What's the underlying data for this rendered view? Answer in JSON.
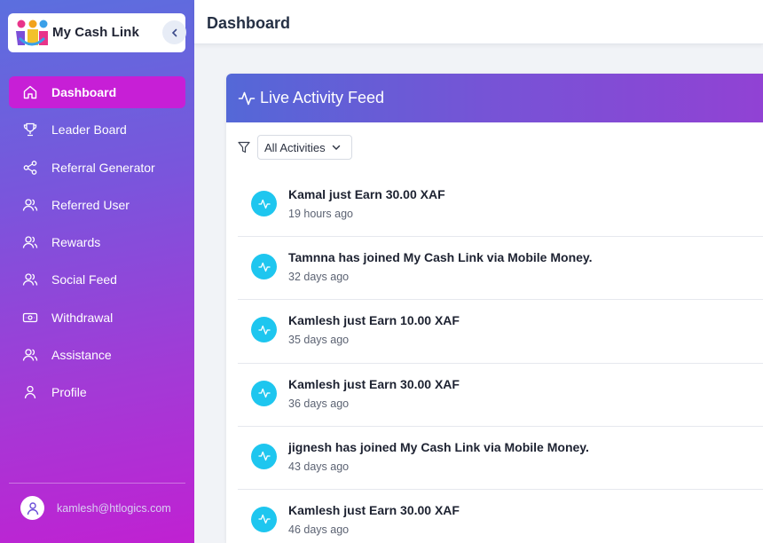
{
  "brand": {
    "name": "My Cash Link"
  },
  "sidebar": {
    "items": [
      {
        "label": "Dashboard",
        "icon": "home-icon",
        "active": true
      },
      {
        "label": "Leader Board",
        "icon": "trophy-icon",
        "active": false
      },
      {
        "label": "Referral Generator",
        "icon": "share-icon",
        "active": false
      },
      {
        "label": "Referred User",
        "icon": "users-icon",
        "active": false
      },
      {
        "label": "Rewards",
        "icon": "users-icon",
        "active": false
      },
      {
        "label": "Social Feed",
        "icon": "users-icon",
        "active": false
      },
      {
        "label": "Withdrawal",
        "icon": "cash-icon",
        "active": false
      },
      {
        "label": "Assistance",
        "icon": "users-icon",
        "active": false
      },
      {
        "label": "Profile",
        "icon": "user-icon",
        "active": false
      }
    ],
    "user_email": "kamlesh@htlogics.com"
  },
  "header": {
    "title": "Dashboard"
  },
  "activity": {
    "title": "Live Activity Feed",
    "filter_value": "All Activities",
    "items": [
      {
        "text": "Kamal just Earn 30.00 XAF",
        "time": "19 hours ago"
      },
      {
        "text": "Tamnna has joined My Cash Link via Mobile Money.",
        "time": "32 days ago"
      },
      {
        "text": "Kamlesh just Earn 10.00 XAF",
        "time": "35 days ago"
      },
      {
        "text": "Kamlesh just Earn 30.00 XAF",
        "time": "36 days ago"
      },
      {
        "text": "jignesh has joined My Cash Link via Mobile Money.",
        "time": "43 days ago"
      },
      {
        "text": "Kamlesh just Earn 30.00 XAF",
        "time": "46 days ago"
      }
    ]
  },
  "colors": {
    "active_nav": "#c71fd6",
    "feed_badge": "#1ec6ef",
    "header_gradient_start": "#5468d7",
    "header_gradient_end": "#9142d4"
  }
}
